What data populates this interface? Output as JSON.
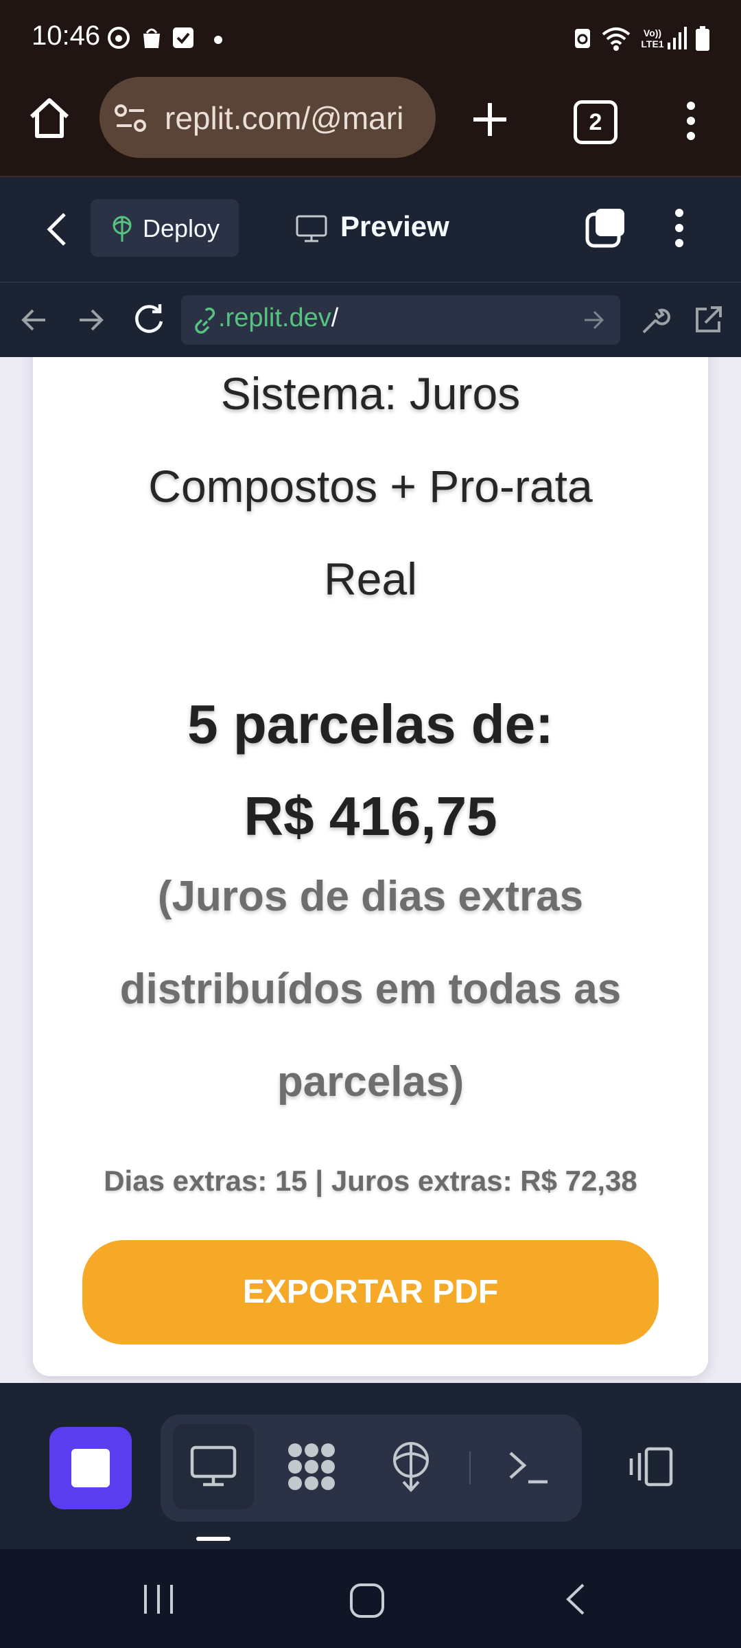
{
  "status_bar": {
    "time": "10:46",
    "icons": [
      "threads-icon",
      "bag-icon",
      "check-icon",
      "dot-icon",
      "battery-saver-icon",
      "wifi-icon",
      "volte-lte-icon",
      "signal-icon",
      "battery-icon"
    ],
    "volte_label": "Vo))",
    "lte_label": "LTE1"
  },
  "browser": {
    "url": "replit.com/@mari",
    "tab_count": "2"
  },
  "replit_header": {
    "deploy_label": "Deploy",
    "preview_label": "Preview"
  },
  "webview": {
    "url_host": ".replit.dev",
    "url_path": "/"
  },
  "content": {
    "system_lines": [
      "Sistema: Juros",
      "Compostos + Pro-rata",
      "Real"
    ],
    "installments_lines": [
      "5 parcelas de:",
      "R$ 416,75"
    ],
    "note_lines": [
      "(Juros de dias extras",
      "distribuídos em todas as",
      "parcelas)"
    ],
    "extras_line": "Dias extras: 15 | Juros extras: R$ 72,38",
    "export_button": "EXPORTAR PDF"
  },
  "colors": {
    "status_bg": "#201512",
    "replit_bg": "#1c2333",
    "replit_surface": "#2b3245",
    "export_orange": "#f6a827",
    "stop_purple": "#5b3df0",
    "link_green": "#58c281"
  }
}
